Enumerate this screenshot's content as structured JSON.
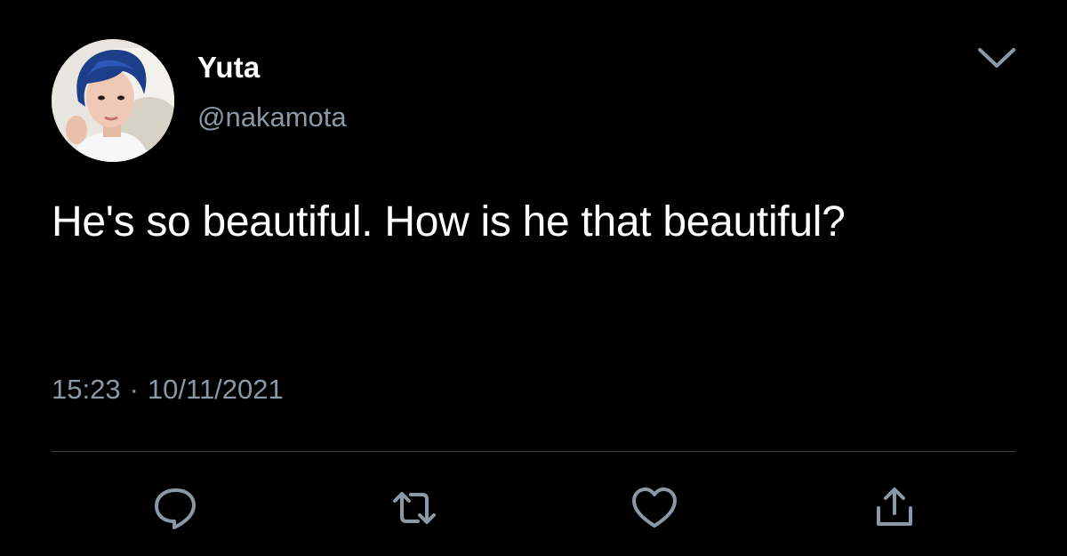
{
  "author": {
    "display_name": "Yuta",
    "handle": "@nakamota"
  },
  "tweet": {
    "text": "He's so beautiful. How is he that beautiful?",
    "time": "15:23",
    "separator": "·",
    "date": "10/11/2021"
  },
  "icons": {
    "more": "chevron-down-icon",
    "reply": "reply-icon",
    "retweet": "retweet-icon",
    "like": "heart-icon",
    "share": "share-icon"
  },
  "colors": {
    "background": "#000000",
    "text": "#ffffff",
    "secondary": "#8b98a5",
    "divider": "#3b4249"
  }
}
